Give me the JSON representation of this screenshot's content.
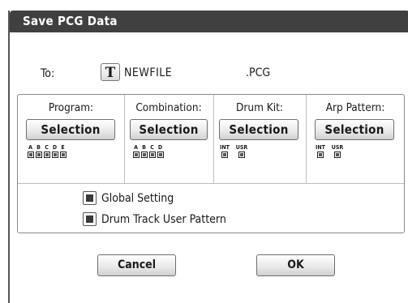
{
  "dialog": {
    "title": "Save PCG Data"
  },
  "destination": {
    "to_label": "To:",
    "text_edit_button": "T",
    "filename": "NEWFILE",
    "extension": ".PCG"
  },
  "columns": [
    {
      "title": "Program:",
      "button": "Selection",
      "banks": [
        "A",
        "B",
        "C",
        "D",
        "E"
      ]
    },
    {
      "title": "Combination:",
      "button": "Selection",
      "banks": [
        "A",
        "B",
        "C",
        "D"
      ]
    },
    {
      "title": "Drum Kit:",
      "button": "Selection",
      "banks": [
        "INT",
        "USR"
      ]
    },
    {
      "title": "Arp Pattern:",
      "button": "Selection",
      "banks": [
        "INT",
        "USR"
      ]
    }
  ],
  "options": {
    "global_setting": {
      "label": "Global Setting",
      "checked": true
    },
    "drum_track_user_pattern": {
      "label": "Drum Track User Pattern",
      "checked": true
    }
  },
  "buttons": {
    "cancel": "Cancel",
    "ok": "OK"
  },
  "colors": {
    "titlebar": "#404040",
    "title_text": "#ffffff"
  }
}
